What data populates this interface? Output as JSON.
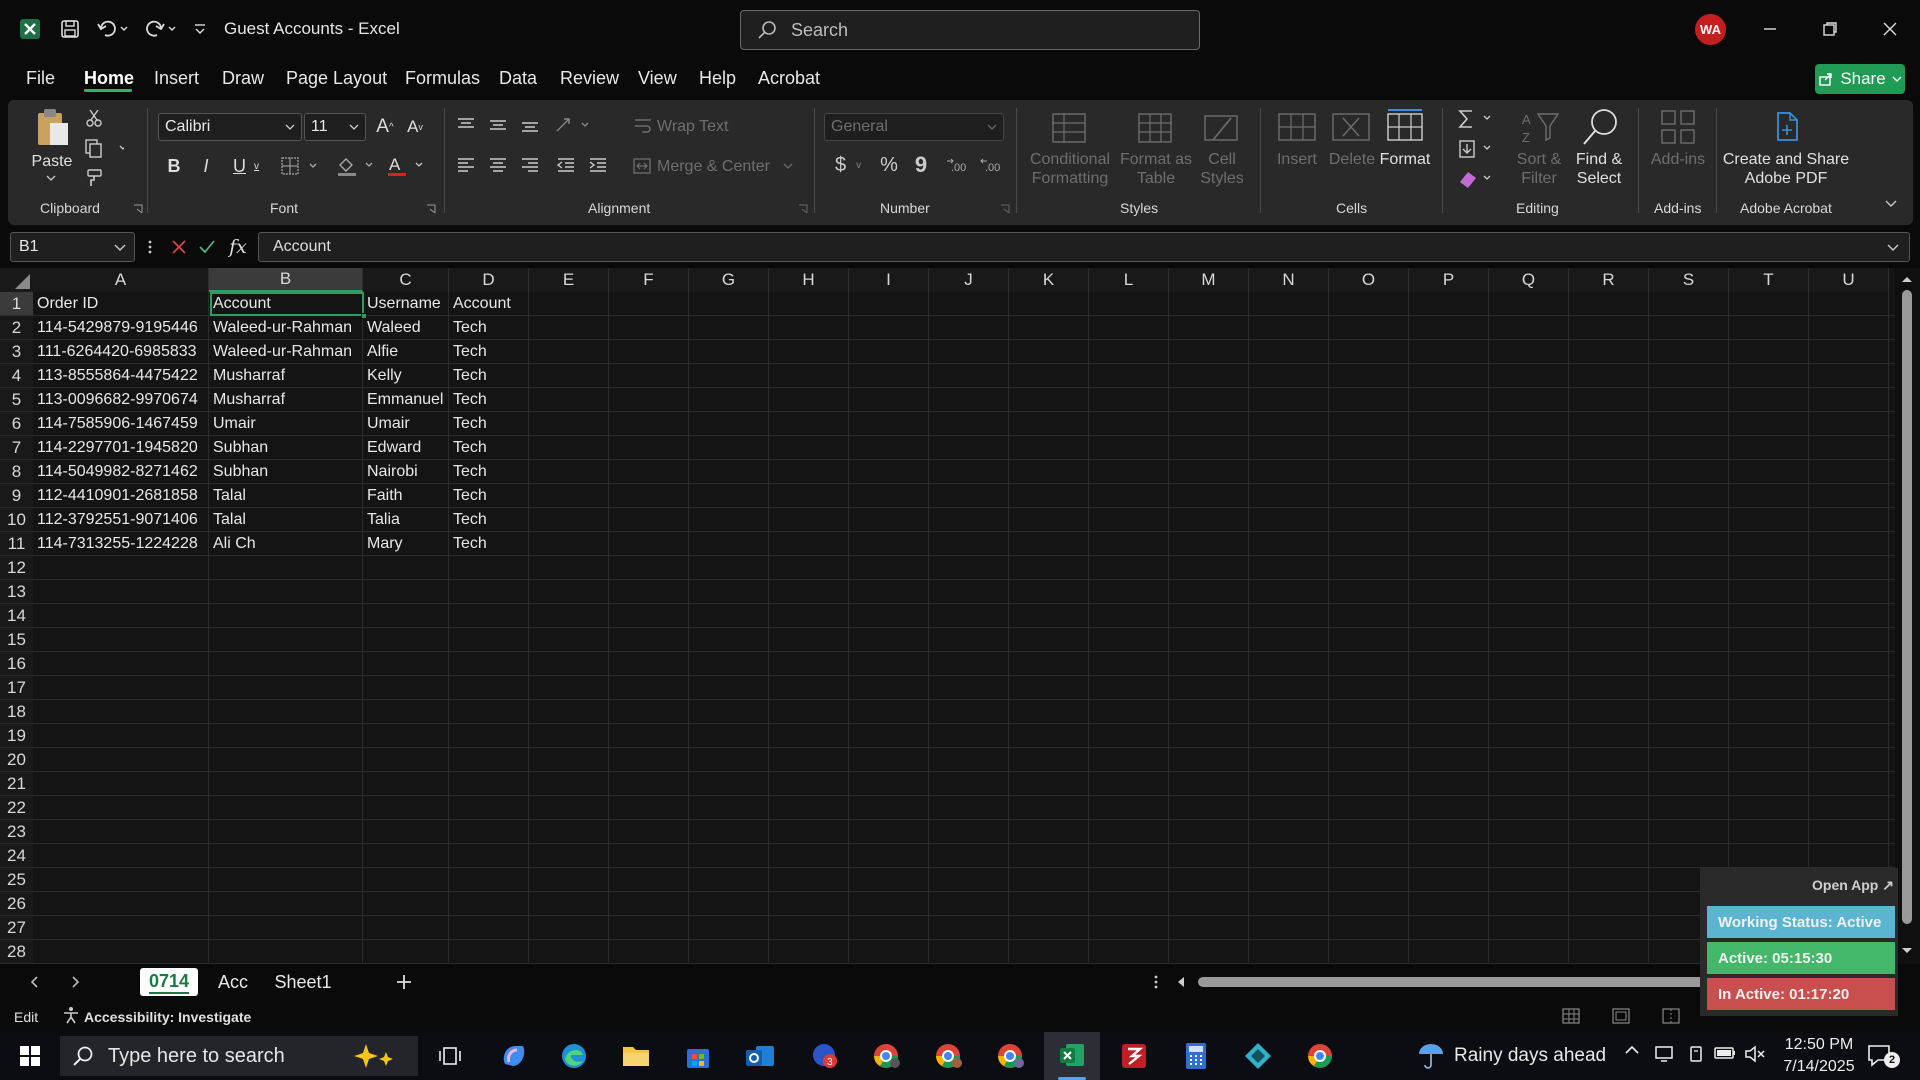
{
  "window": {
    "title": "Guest Accounts  -  Excel",
    "search_placeholder": "Search",
    "avatar_initials": "WA",
    "share_label": "Share"
  },
  "menu": [
    "File",
    "Home",
    "Insert",
    "Draw",
    "Page Layout",
    "Formulas",
    "Data",
    "Review",
    "View",
    "Help",
    "Acrobat"
  ],
  "ribbon": {
    "clipboard": {
      "paste": "Paste",
      "group": "Clipboard"
    },
    "font": {
      "name": "Calibri",
      "size": "11",
      "group": "Font"
    },
    "alignment": {
      "wrap": "Wrap Text",
      "merge": "Merge & Center",
      "group": "Alignment"
    },
    "number": {
      "format": "General",
      "group": "Number"
    },
    "styles": {
      "conditional": "Conditional\nFormatting",
      "format_table": "Format as\nTable",
      "cell_styles": "Cell\nStyles",
      "group": "Styles"
    },
    "cells": {
      "insert": "Insert",
      "delete": "Delete",
      "format": "Format",
      "group": "Cells"
    },
    "editing": {
      "sort": "Sort &\nFilter",
      "find": "Find &\nSelect",
      "group": "Editing"
    },
    "addins": {
      "label": "Add-ins",
      "group": "Add-ins"
    },
    "acrobat": {
      "label": "Create and Share\nAdobe PDF",
      "group": "Adobe Acrobat"
    }
  },
  "formula_bar": {
    "name_box": "B1",
    "fx": "fx",
    "value": "Account"
  },
  "columns": [
    "A",
    "B",
    "C",
    "D",
    "E",
    "F",
    "G",
    "H",
    "I",
    "J",
    "K",
    "L",
    "M",
    "N",
    "O",
    "P",
    "Q",
    "R",
    "S",
    "T",
    "U"
  ],
  "rows": [
    "1",
    "2",
    "3",
    "4",
    "5",
    "6",
    "7",
    "8",
    "9",
    "10",
    "11",
    "12",
    "13",
    "14",
    "15",
    "16",
    "17",
    "18",
    "19",
    "20",
    "21",
    "22",
    "23",
    "24",
    "25",
    "26",
    "27",
    "28"
  ],
  "table": [
    [
      "Order ID",
      "Account",
      "Username",
      "Account"
    ],
    [
      "114-5429879-9195446",
      "Waleed-ur-Rahman",
      "Waleed",
      "Tech"
    ],
    [
      "111-6264420-6985833",
      "Waleed-ur-Rahman",
      "Alfie",
      "Tech"
    ],
    [
      "113-8555864-4475422",
      "Musharraf",
      "Kelly",
      "Tech"
    ],
    [
      "113-0096682-9970674",
      "Musharraf",
      "Emmanuel",
      "Tech"
    ],
    [
      "114-7585906-1467459",
      "Umair",
      "Umair",
      "Tech"
    ],
    [
      "114-2297701-1945820",
      "Subhan",
      "Edward",
      "Tech"
    ],
    [
      "114-5049982-8271462",
      "Subhan",
      "Nairobi",
      "Tech"
    ],
    [
      "112-4410901-2681858",
      "Talal",
      "Faith",
      "Tech"
    ],
    [
      "112-3792551-9071406",
      "Talal",
      "Talia",
      "Tech"
    ],
    [
      "114-7313255-1224228",
      "Ali Ch",
      "Mary",
      "Tech"
    ]
  ],
  "sheets": [
    "0714",
    "Acc",
    "Sheet1"
  ],
  "active_sheet": "0714",
  "status": {
    "mode": "Edit",
    "accessibility": "Accessibility: Investigate"
  },
  "widget": {
    "open_app": "Open App",
    "working": "Working Status: Active",
    "active": "Active: 05:15:30",
    "inactive": "In Active: 01:17:20",
    "colors": {
      "working": "#5bb5d0",
      "active": "#43b86a",
      "inactive": "#c94f4f"
    }
  },
  "taskbar": {
    "search_placeholder": "Type here to search",
    "weather": "Rainy days ahead",
    "time": "12:50 PM",
    "date": "7/14/2025",
    "notifications": "2",
    "outlook_badge": "3"
  }
}
